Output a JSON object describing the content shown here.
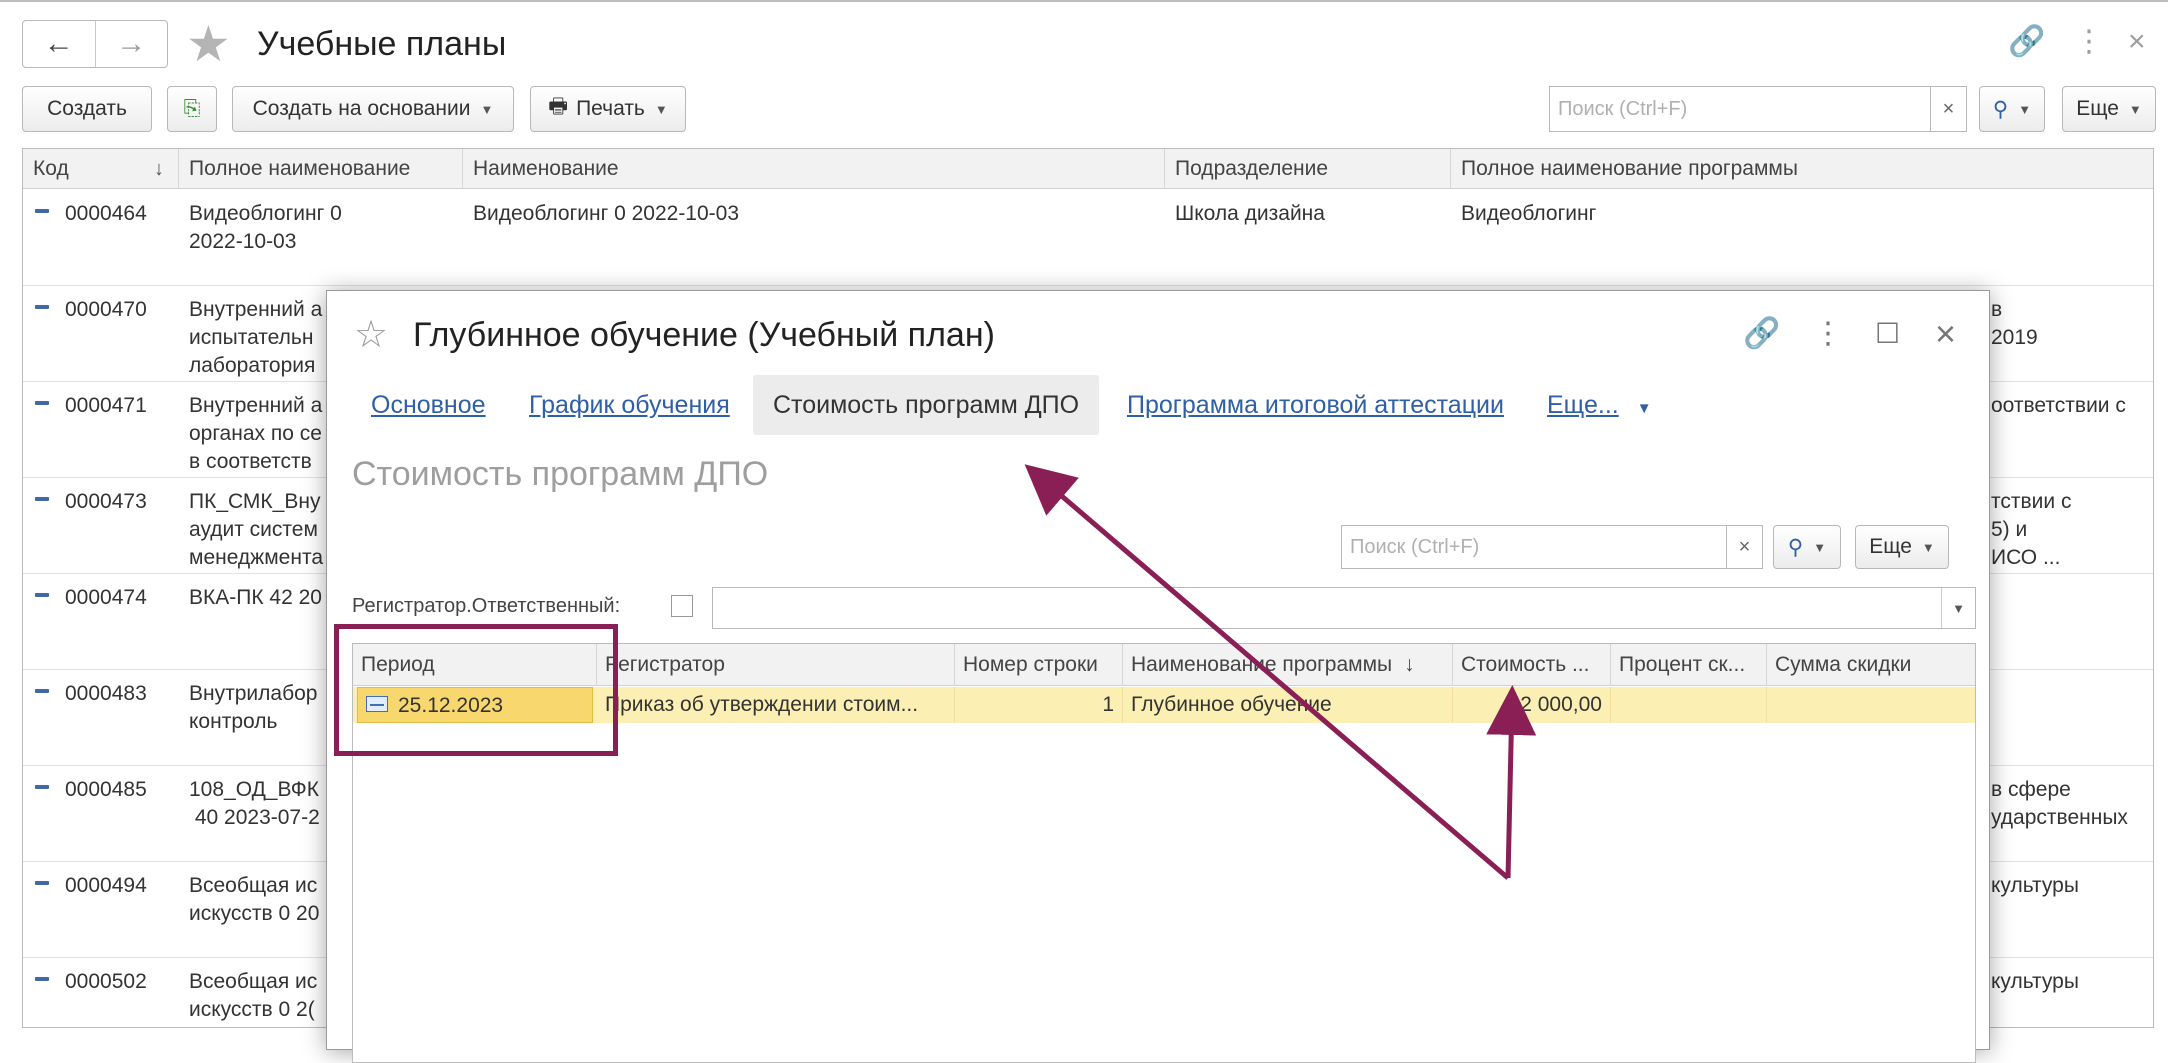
{
  "main": {
    "title": "Учебные планы",
    "toolbar": {
      "create": "Создать",
      "create_based_on": "Создать на основании",
      "print": "Печать",
      "search_placeholder": "Поиск (Ctrl+F)",
      "more": "Еще"
    },
    "columns": [
      "Код",
      "Полное наименование",
      "Наименование",
      "Подразделение",
      "Полное наименование программы"
    ],
    "rows": [
      {
        "code": "0000464",
        "full_name": "Видеоблогинг 0\n2022-10-03",
        "name": "Видеоблогинг 0 2022-10-03",
        "division": "Школа дизайна",
        "program": "Видеоблогинг"
      },
      {
        "code": "0000470",
        "full_name": "Внутренний а\nиспытательн\nлаборатория",
        "name": "",
        "division": "",
        "program": "в\n2019"
      },
      {
        "code": "0000471",
        "full_name": "Внутренний а\nорганах по се\nв соответств",
        "name": "",
        "division": "",
        "program": "оответствии с"
      },
      {
        "code": "0000473",
        "full_name": "ПК_СМК_Вну\nаудит систем\nменеджмента",
        "name": "",
        "division": "",
        "program": "тствии с\n5) и\nИСО ..."
      },
      {
        "code": "0000474",
        "full_name": "ВКА-ПК 42 20",
        "name": "",
        "division": "",
        "program": ""
      },
      {
        "code": "0000483",
        "full_name": "Внутрилабор\nконтроль",
        "name": "",
        "division": "",
        "program": ""
      },
      {
        "code": "0000485",
        "full_name": "108_ОД_ВФК\n 40 2023-07-2",
        "name": "",
        "division": "",
        "program": "в сфере\nударственных"
      },
      {
        "code": "0000494",
        "full_name": "Всеобщая ис\nискусств 0 20",
        "name": "",
        "division": "",
        "program": "культуры"
      },
      {
        "code": "0000502",
        "full_name": "Всеобщая ис\nискусств 0 2(",
        "name": "",
        "division": "",
        "program": "культуры"
      }
    ]
  },
  "modal": {
    "title": "Глубинное обучение (Учебный план)",
    "tabs": [
      "Основное",
      "График обучения",
      "Стоимость программ ДПО",
      "Программа итоговой аттестации",
      "Еще..."
    ],
    "section_title": "Стоимость программ ДПО",
    "search_placeholder": "Поиск (Ctrl+F)",
    "more": "Еще",
    "filter_label": "Регистратор.Ответственный:",
    "columns": [
      "Период",
      "Регистратор",
      "Номер строки",
      "Наименование программы",
      "Стоимость ...",
      "Процент ск...",
      "Сумма скидки"
    ],
    "row": {
      "period": "25.12.2023",
      "registrar": "Приказ об утверждении стоим...",
      "line_no": "1",
      "program": "Глубинное обучение",
      "cost": "12 000,00",
      "discount_pct": "",
      "discount_sum": ""
    }
  },
  "colors": {
    "annotation": "#8a1f55",
    "selected_row": "#fcefb4",
    "link": "#2f5fa6"
  },
  "icons": [
    "arrow-left-icon",
    "arrow-right-icon",
    "star-icon",
    "link-icon",
    "more-icon",
    "close-icon",
    "add-copy-icon",
    "printer-icon",
    "search-icon",
    "maximize-icon",
    "period-icon"
  ]
}
